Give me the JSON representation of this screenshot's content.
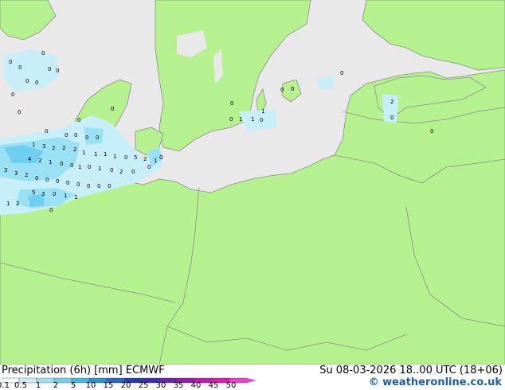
{
  "header": {
    "title_left": "Precipitation (6h) [mm] ECMWF",
    "title_right": "Su 08-03-2026 18..00 UTC (18+06)",
    "credit": "© weatheronline.co.uk"
  },
  "legend": {
    "ticks": [
      "0.1",
      "0.5",
      "1",
      "2",
      "5",
      "10",
      "15",
      "20",
      "25",
      "30",
      "35",
      "40",
      "45",
      "50"
    ],
    "colors": [
      "#f0faff",
      "#c8eefa",
      "#9be1f5",
      "#6ecff0",
      "#41b9e6",
      "#2891d7",
      "#2069c8",
      "#1e3cb4",
      "#3c28b4",
      "#6e1eb4",
      "#a014b4",
      "#c814b4",
      "#e614b4",
      "#f03cd2"
    ]
  },
  "map": {
    "land_color": "#b6f190",
    "sea_color": "#e9e9e9",
    "border_color": "#8c8c8c",
    "values": [
      "0",
      "0",
      "0",
      "0",
      "0",
      "0",
      "0",
      "0",
      "0",
      "0",
      "0",
      "0",
      "0",
      "0",
      "0",
      "0",
      "1",
      "0",
      "0",
      "0",
      "0",
      "1",
      "1",
      "0",
      "0",
      "0",
      "2",
      "0",
      "1",
      "3",
      "2",
      "2",
      "2",
      "1",
      "1",
      "1",
      "1",
      "0",
      "5",
      "2",
      "4",
      "2",
      "1",
      "0",
      "0",
      "1",
      "0",
      "1",
      "0",
      "2",
      "3",
      "3",
      "2",
      "0",
      "0",
      "0",
      "0",
      "0",
      "0",
      "0",
      "1",
      "2",
      "5",
      "3",
      "0",
      "1",
      "1",
      "0",
      "0",
      "0",
      "0",
      "0",
      "1"
    ]
  }
}
